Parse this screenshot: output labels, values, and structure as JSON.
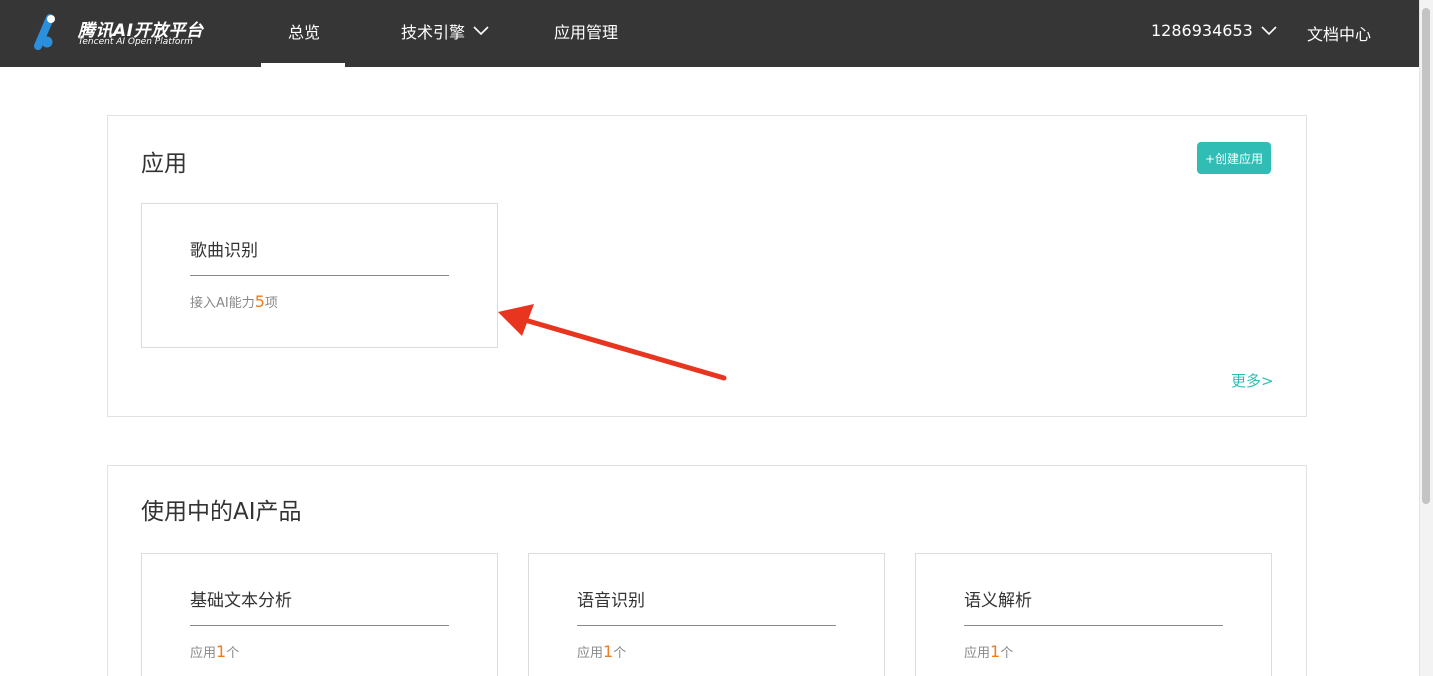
{
  "logo": {
    "name_cn": "腾讯AI开放平台",
    "name_en": "Tencent AI Open Platform"
  },
  "nav": {
    "overview": "总览",
    "tech_engine": "技术引擎",
    "app_management": "应用管理",
    "account": "1286934653",
    "docs": "文档中心"
  },
  "apps_section": {
    "title": "应用",
    "create_button": "+创建应用",
    "more": "更多>",
    "cards": [
      {
        "title": "歌曲识别",
        "meta_prefix": "接入AI能力",
        "count": "5",
        "meta_suffix": "项"
      }
    ]
  },
  "products_section": {
    "title": "使用中的AI产品",
    "cards": [
      {
        "title": "基础文本分析",
        "meta_prefix": "应用",
        "count": "1",
        "meta_suffix": "个"
      },
      {
        "title": "语音识别",
        "meta_prefix": "应用",
        "count": "1",
        "meta_suffix": "个"
      },
      {
        "title": "语义解析",
        "meta_prefix": "应用",
        "count": "1",
        "meta_suffix": "个"
      }
    ]
  },
  "colors": {
    "topbar": "#363636",
    "accent": "#2fbdb5",
    "number": "#f07c1e",
    "annotation_arrow": "#e8351f"
  }
}
